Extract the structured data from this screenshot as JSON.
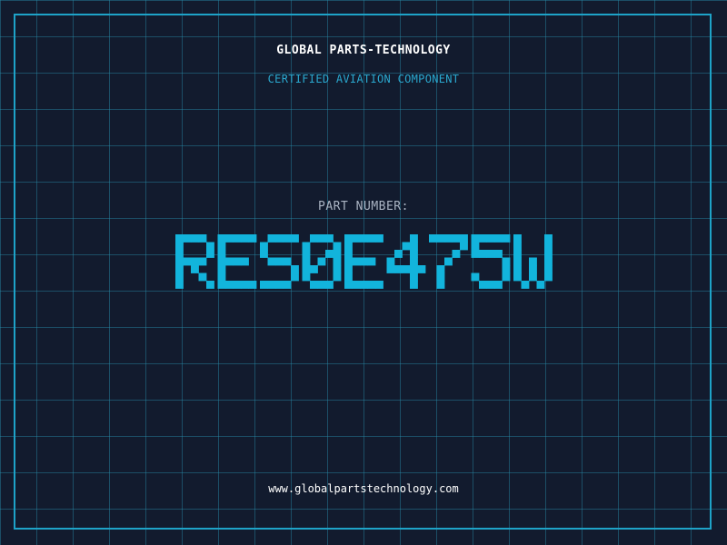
{
  "header": {
    "company": "GLOBAL PARTS-TECHNOLOGY",
    "subtitle": "CERTIFIED AVIATION COMPONENT"
  },
  "part": {
    "label": "PART NUMBER:",
    "number": "RESOE475W"
  },
  "footer": {
    "url": "www.globalpartstechnology.com"
  },
  "colors": {
    "background": "#121b2e",
    "grid": "#288caa",
    "accent": "#1ea3c8",
    "part_number": "#12b4dc"
  }
}
